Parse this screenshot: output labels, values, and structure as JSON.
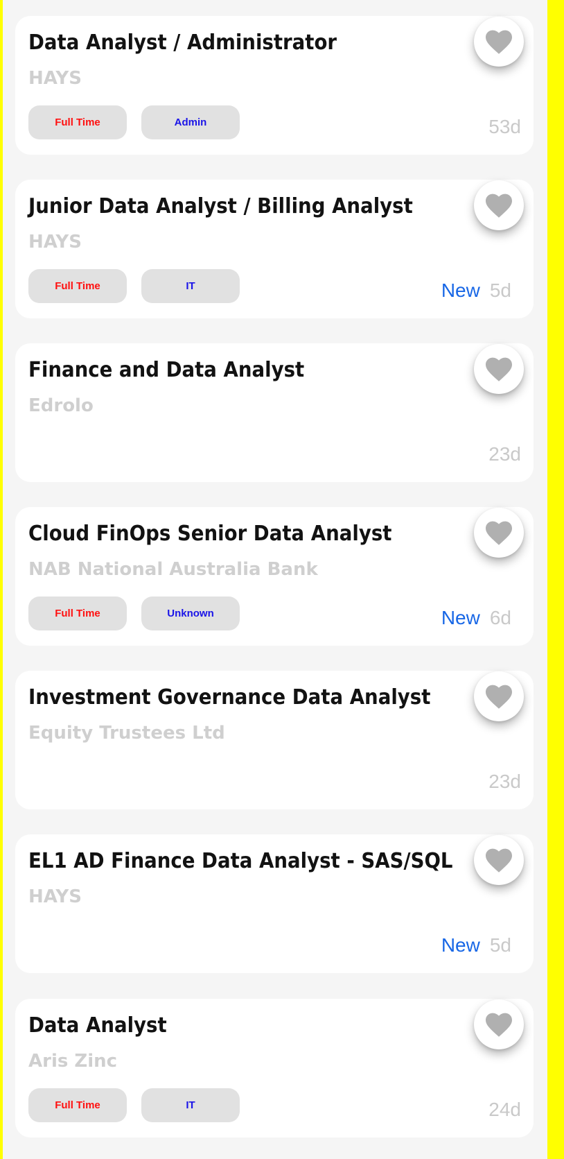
{
  "colors": {
    "page_background": "#ffff00",
    "list_background": "#f5f5f5",
    "card_background": "#ffffff",
    "title": "#121212",
    "company": "#cfcfcf",
    "type_tag_text": "#ff1010",
    "category_tag_text": "#1a14e8",
    "tag_background": "#e1e1e1",
    "new_badge": "#1867e6",
    "age": "#c9c9c9",
    "heart_icon": "#b0b0b0"
  },
  "icons": {
    "favorite": "heart-icon"
  },
  "jobs": [
    {
      "title": "Data Analyst / Administrator",
      "company": "HAYS",
      "type_tag": "Full Time",
      "category_tag": "Admin",
      "new_label": "",
      "age": "53d"
    },
    {
      "title": "Junior Data Analyst / Billing Analyst",
      "company": "HAYS",
      "type_tag": "Full Time",
      "category_tag": "IT",
      "new_label": "New",
      "age": "5d"
    },
    {
      "title": "Finance and Data Analyst",
      "company": "Edrolo",
      "type_tag": "",
      "category_tag": "",
      "new_label": "",
      "age": "23d"
    },
    {
      "title": "Cloud FinOps Senior Data Analyst",
      "company": "NAB National Australia Bank",
      "type_tag": "Full Time",
      "category_tag": "Unknown",
      "new_label": "New",
      "age": "6d"
    },
    {
      "title": "Investment Governance Data Analyst",
      "company": "Equity Trustees Ltd",
      "type_tag": "",
      "category_tag": "",
      "new_label": "",
      "age": "23d"
    },
    {
      "title": "EL1 AD Finance Data Analyst - SAS/SQL",
      "company": "HAYS",
      "type_tag": "",
      "category_tag": "",
      "new_label": "New",
      "age": "5d"
    },
    {
      "title": "Data Analyst",
      "company": "Aris Zinc",
      "type_tag": "Full Time",
      "category_tag": "IT",
      "new_label": "",
      "age": "24d"
    }
  ]
}
